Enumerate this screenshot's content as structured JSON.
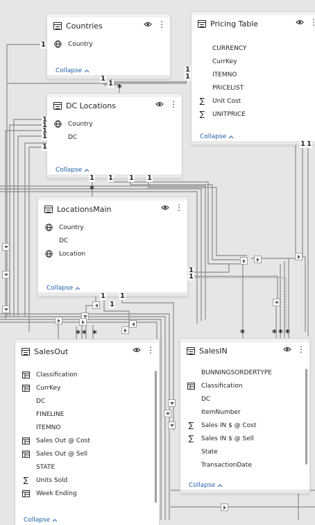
{
  "cards": {
    "countries": {
      "title": "Countries",
      "fields": [
        {
          "name": "Country",
          "icon": "globe-icon"
        }
      ],
      "collapse_label": "Collapse"
    },
    "pricing_table": {
      "title": "Pricing Table",
      "fields": [
        {
          "name": "CURRENCY",
          "icon": ""
        },
        {
          "name": "CurrKey",
          "icon": ""
        },
        {
          "name": "ITEMNO",
          "icon": ""
        },
        {
          "name": "PRICELIST",
          "icon": ""
        },
        {
          "name": "Unit Cost",
          "icon": "sigma-icon"
        },
        {
          "name": "UNITPRICE",
          "icon": "sigma-icon"
        }
      ],
      "collapse_label": "Collapse"
    },
    "dc_locations": {
      "title": "DC Locations",
      "fields": [
        {
          "name": "Country",
          "icon": "globe-icon"
        },
        {
          "name": "DC",
          "icon": ""
        }
      ],
      "collapse_label": "Collapse"
    },
    "locations_main": {
      "title": "LocationsMain",
      "fields": [
        {
          "name": "Country",
          "icon": "globe-icon"
        },
        {
          "name": "DC",
          "icon": ""
        },
        {
          "name": "Location",
          "icon": "globe-icon"
        }
      ],
      "collapse_label": "Collapse"
    },
    "sales_out": {
      "title": "SalesOut",
      "fields": [
        {
          "name": "Classification",
          "icon": "calc-table-icon"
        },
        {
          "name": "CurrKey",
          "icon": "calc-table-icon"
        },
        {
          "name": "DC",
          "icon": ""
        },
        {
          "name": "FINELINE",
          "icon": ""
        },
        {
          "name": "ITEMNO",
          "icon": ""
        },
        {
          "name": "Sales Out @ Cost",
          "icon": "calc-table-icon"
        },
        {
          "name": "Sales Out @ Sell",
          "icon": "calc-table-icon"
        },
        {
          "name": "STATE",
          "icon": ""
        },
        {
          "name": "Units Sold",
          "icon": "sigma-icon"
        },
        {
          "name": "Week Ending",
          "icon": "calc-table-icon"
        }
      ],
      "collapse_label": "Collapse"
    },
    "sales_in": {
      "title": "SalesIN",
      "fields": [
        {
          "name": "BUNNINGSORDERTYPE",
          "icon": ""
        },
        {
          "name": "Classification",
          "icon": "calc-table-icon"
        },
        {
          "name": "DC",
          "icon": ""
        },
        {
          "name": "ItemNumber",
          "icon": ""
        },
        {
          "name": "Sales IN $ @ Cost",
          "icon": "sigma-icon"
        },
        {
          "name": "Sales IN $ @ Sell",
          "icon": "sigma-icon"
        },
        {
          "name": "State",
          "icon": ""
        },
        {
          "name": "TransactionDate",
          "icon": ""
        }
      ],
      "collapse_label": "Collapse"
    }
  },
  "relationship_markers": {
    "one": "1",
    "many": "*"
  },
  "colors": {
    "canvas": "#e6e6e6",
    "card": "#ffffff",
    "line": "#8a8886",
    "link": "#1f5ea8"
  }
}
